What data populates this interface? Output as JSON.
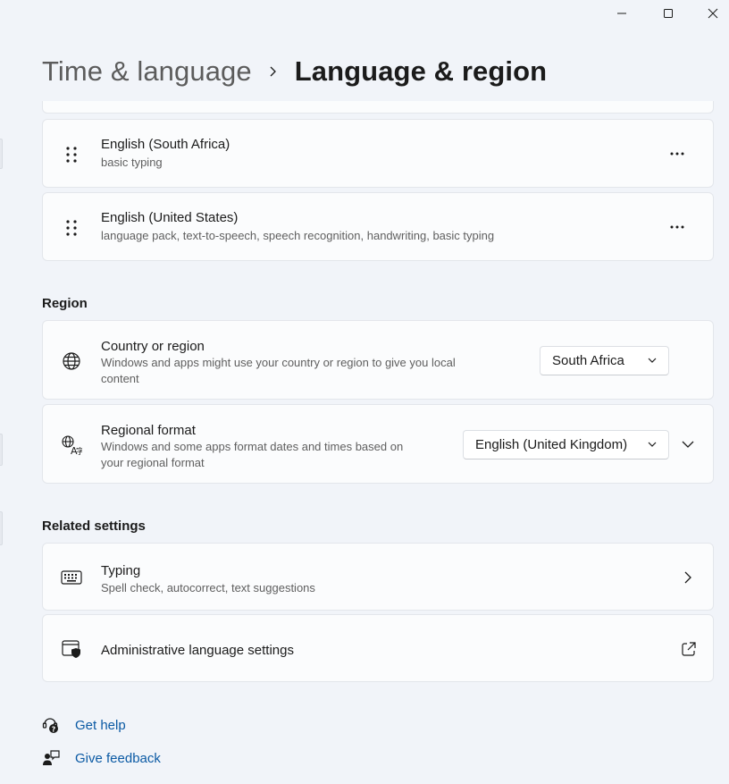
{
  "window": {
    "minimize_icon": "minimize-icon",
    "maximize_icon": "maximize-icon",
    "close_icon": "close-icon"
  },
  "breadcrumb": {
    "parent": "Time & language",
    "separator_icon": "chevron-right-icon",
    "current": "Language & region"
  },
  "languages": [
    {
      "name": "English (South Africa)",
      "features": "basic typing",
      "drag_icon": "drag-handle-icon",
      "more_icon": "more-icon"
    },
    {
      "name": "English (United States)",
      "features": "language pack, text-to-speech, speech recognition, handwriting, basic typing",
      "drag_icon": "drag-handle-icon",
      "more_icon": "more-icon"
    }
  ],
  "region": {
    "header": "Region",
    "country": {
      "icon": "globe-icon",
      "title": "Country or region",
      "desc_line1": "Windows and apps might use your country or region to give you local",
      "desc_line2": "content",
      "selected": "South Africa"
    },
    "format": {
      "icon": "language-format-icon",
      "title": "Regional format",
      "desc_line1": "Windows and some apps format dates and times based on",
      "desc_line2": "your regional format",
      "selected": "English (United Kingdom)"
    }
  },
  "related": {
    "header": "Related settings",
    "typing": {
      "icon": "keyboard-icon",
      "title": "Typing",
      "desc": "Spell check, autocorrect, text suggestions"
    },
    "admin": {
      "icon": "admin-shield-icon",
      "title": "Administrative language settings"
    }
  },
  "footer": {
    "help": "Get help",
    "feedback": "Give feedback"
  },
  "colors": {
    "background": "#f1f4f9",
    "card": "#fbfcfd",
    "link": "#0b5aa4",
    "text": "#1b1b1b",
    "secondary_text": "#5f5f5f"
  }
}
